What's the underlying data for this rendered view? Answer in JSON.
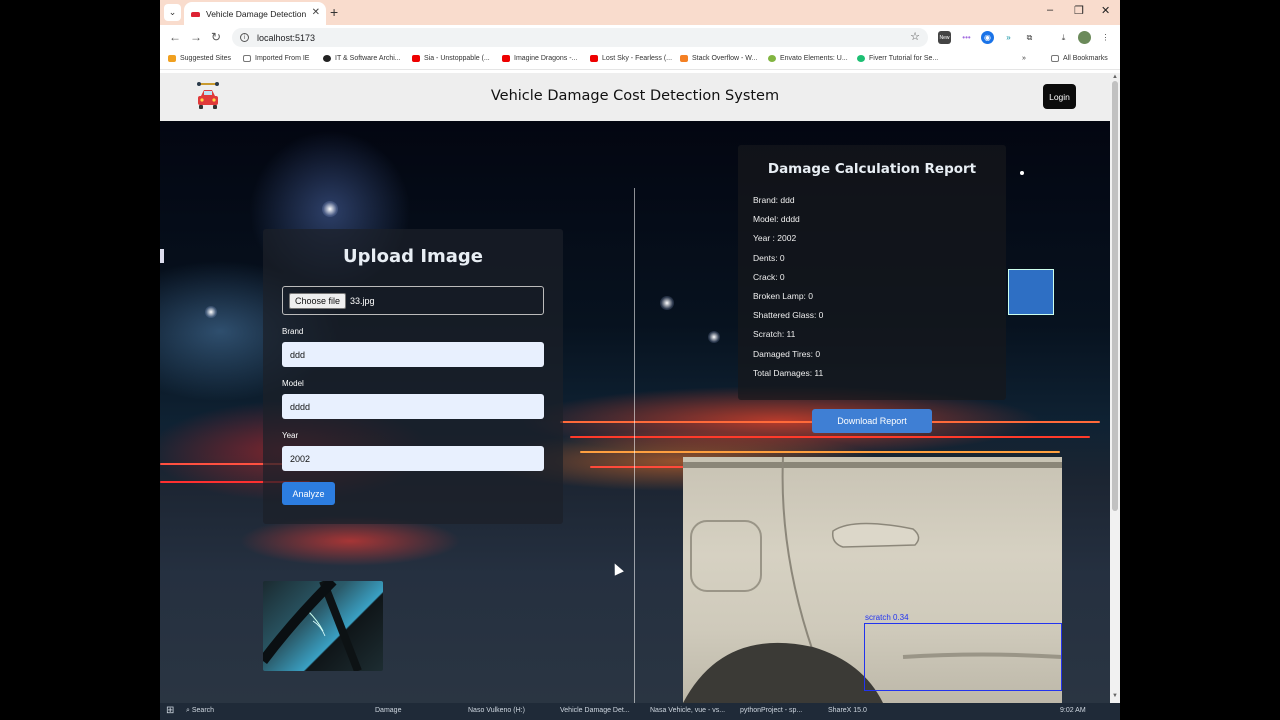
{
  "browser": {
    "tab_title": "Vehicle Damage Detection",
    "url": "localhost:5173",
    "bookmarks": [
      "Suggested Sites",
      "Imported From IE",
      "IT & Software Archi...",
      "Sia - Unstoppable (...",
      "Imagine Dragons -...",
      "Lost Sky - Fearless (...",
      "Stack Overflow - W...",
      "Envato Elements: U...",
      "Fiverr Tutorial for Se..."
    ],
    "all_bookmarks": "All Bookmarks",
    "ext_new_badge": "New"
  },
  "app": {
    "title": "Vehicle Damage Cost Detection System",
    "login_label": "Login"
  },
  "upload": {
    "title": "Upload Image",
    "choose_file_label": "Choose file",
    "file_name": "33.jpg",
    "brand_label": "Brand",
    "brand_value": "ddd",
    "model_label": "Model",
    "model_value": "dddd",
    "year_label": "Year",
    "year_value": "2002",
    "analyze_label": "Analyze"
  },
  "report": {
    "title": "Damage Calculation Report",
    "lines": [
      "Brand: ddd",
      "Model: dddd",
      "Year : 2002",
      "Dents: 0",
      "Crack: 0",
      "Broken Lamp: 0",
      "Shattered Glass: 0",
      "Scratch: 11",
      "Damaged Tires: 0",
      "Total Damages: 11"
    ],
    "download_label": "Download Report"
  },
  "detection": {
    "label": "scratch  0.34"
  },
  "taskbar": {
    "search": "Search",
    "items": [
      "Damage",
      "Naso Vulkeno (H:)",
      "Vehicle Damage Det...",
      "Nasa Vehicle, vue - vs...",
      "pythonProject - sp...",
      "ShareX 15.0"
    ],
    "time": "9:02 AM"
  }
}
